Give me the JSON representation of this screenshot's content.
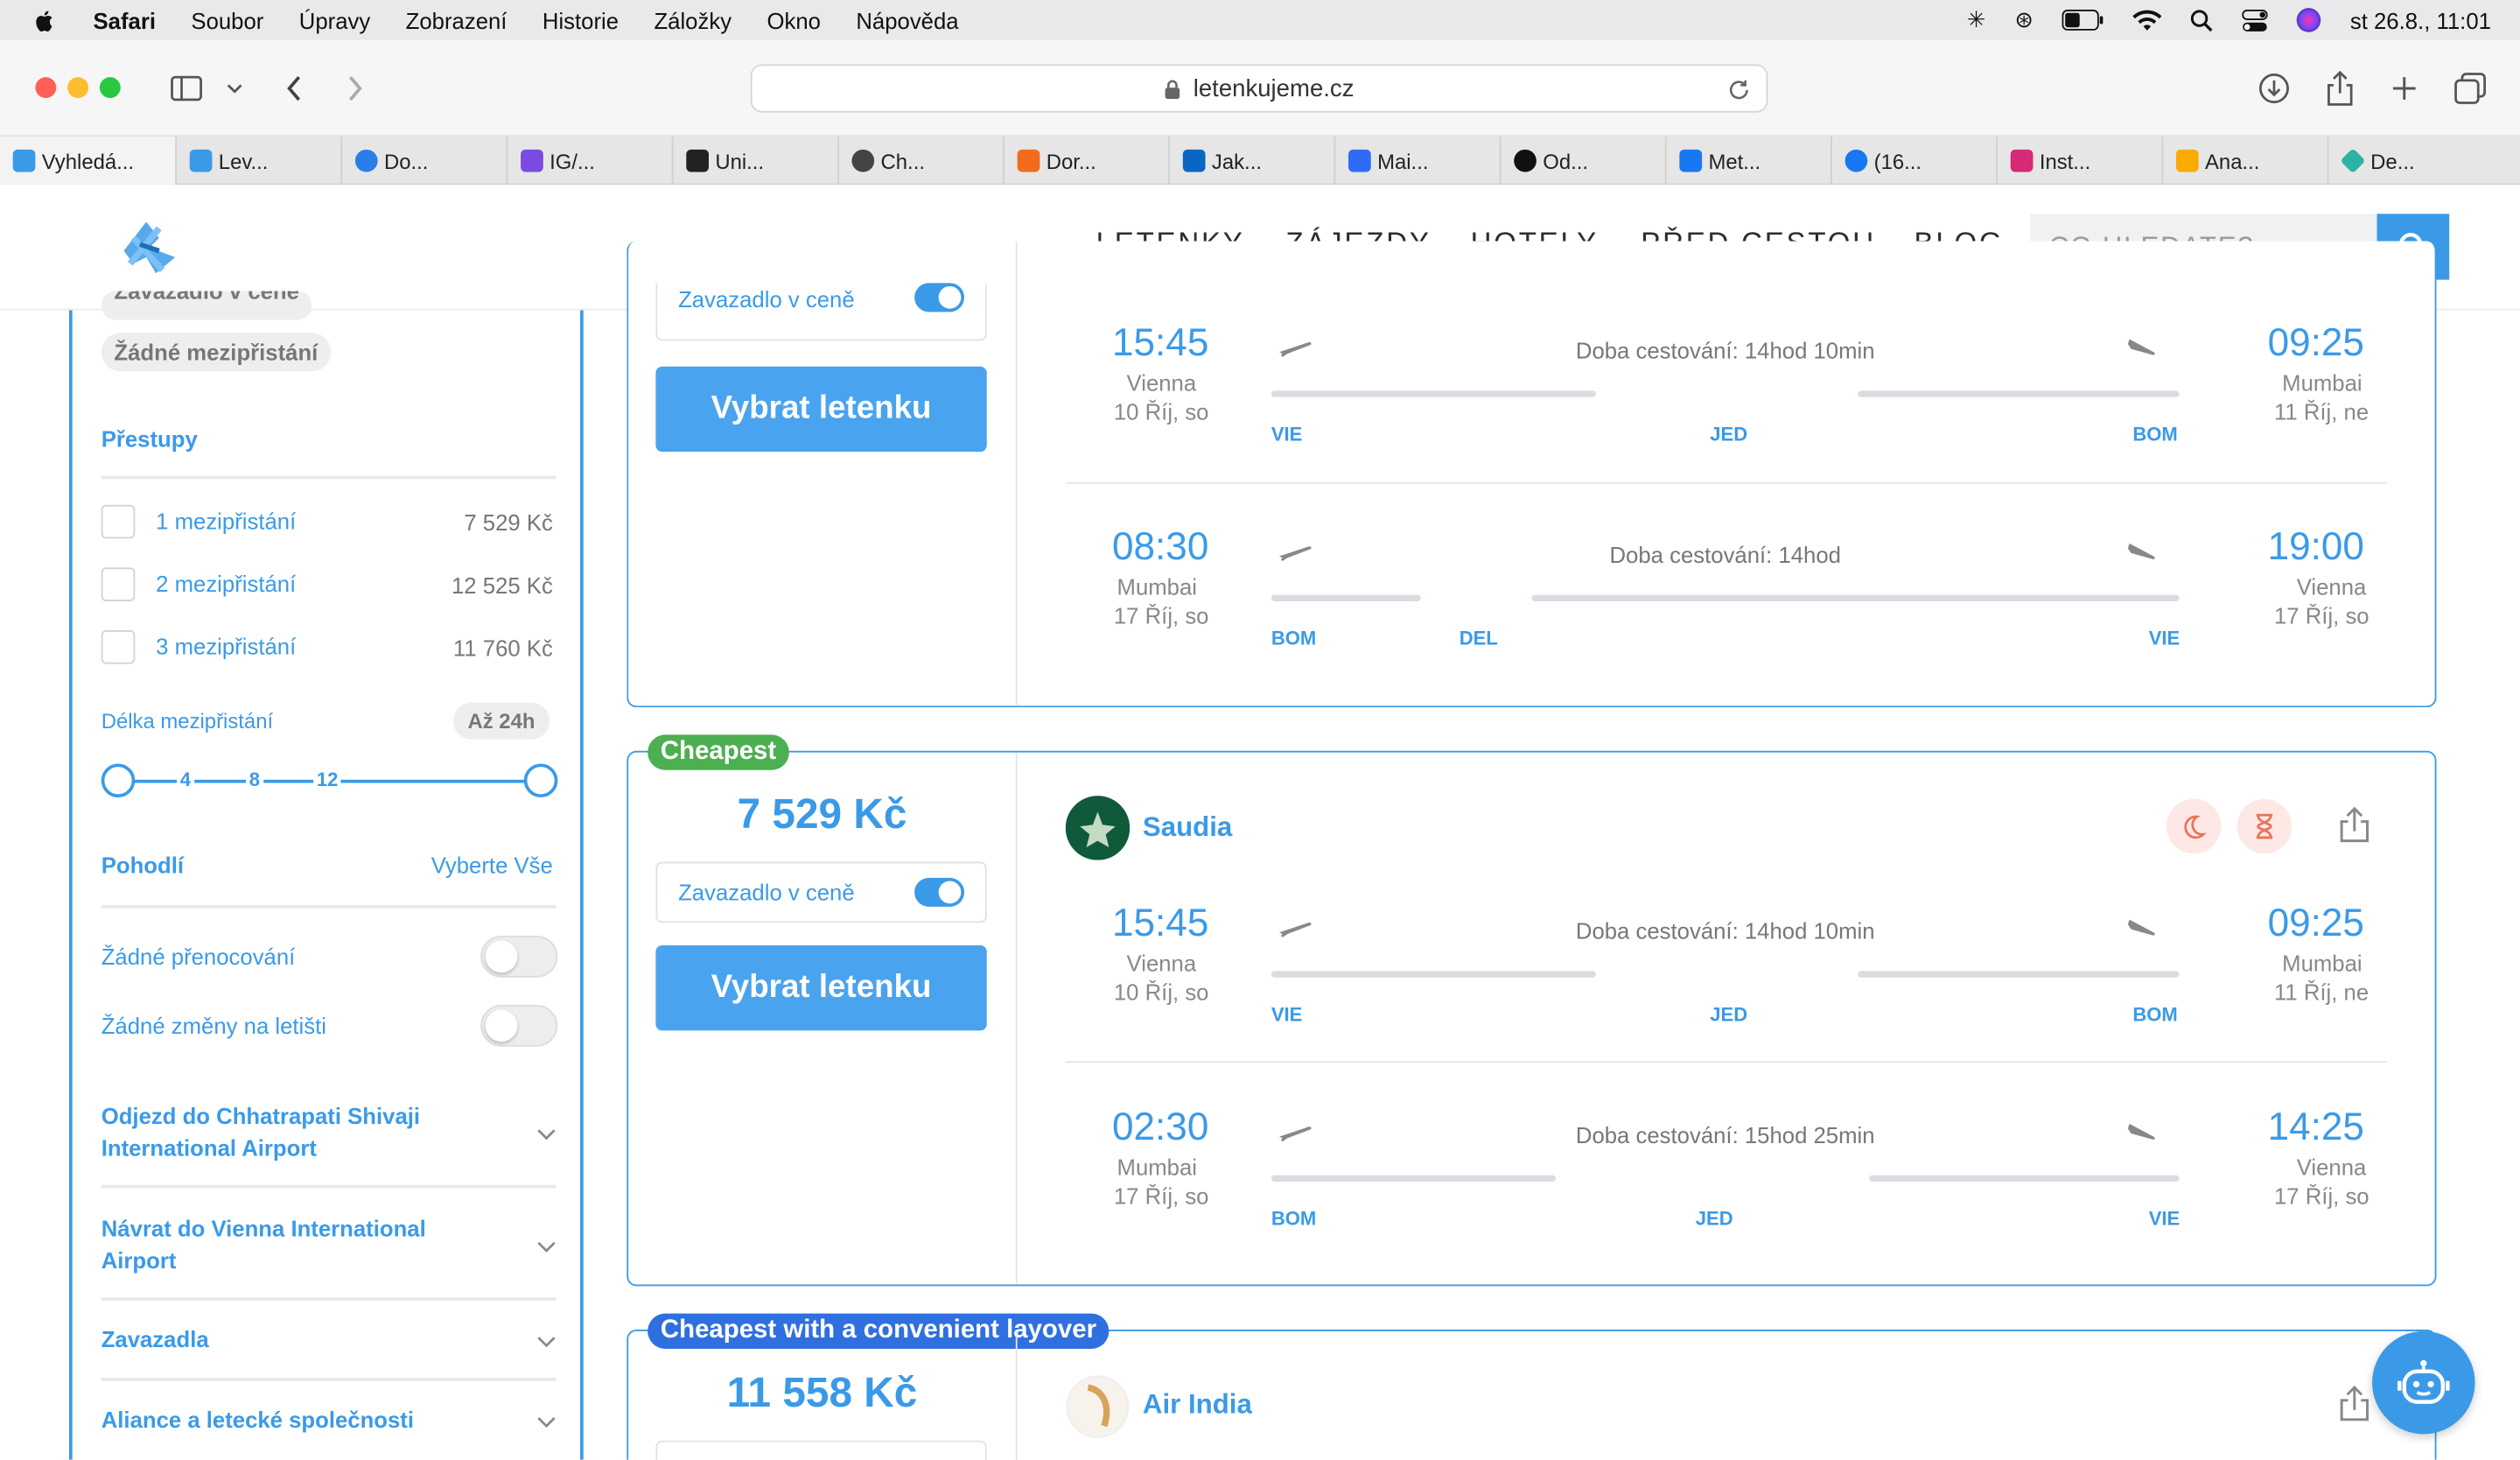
{
  "menubar": {
    "app": "Safari",
    "items": [
      "Soubor",
      "Úpravy",
      "Zobrazení",
      "Historie",
      "Záložky",
      "Okno",
      "Nápověda"
    ],
    "clock": "st 26.8., 11:01"
  },
  "browser": {
    "url": "letenkujeme.cz",
    "tabs": [
      {
        "label": "Vyhledá...",
        "color": "#3a9ae8"
      },
      {
        "label": "Lev...",
        "color": "#3a9ae8"
      },
      {
        "label": "Do...",
        "color": "#2b7de9"
      },
      {
        "label": "IG/...",
        "color": "#7b4ae2"
      },
      {
        "label": "Uni...",
        "color": "#222222"
      },
      {
        "label": "Ch...",
        "color": "#444444"
      },
      {
        "label": "Dor...",
        "color": "#f26b1d"
      },
      {
        "label": "Jak...",
        "color": "#0a66c2"
      },
      {
        "label": "Mai...",
        "color": "#2f6cf6"
      },
      {
        "label": "Od...",
        "color": "#111111"
      },
      {
        "label": "Met...",
        "color": "#1877f2"
      },
      {
        "label": "(16...",
        "color": "#1877f2"
      },
      {
        "label": "Inst...",
        "color": "#d62976"
      },
      {
        "label": "Ana...",
        "color": "#f9ab00"
      },
      {
        "label": "De...",
        "color": "#2bb3a3"
      }
    ]
  },
  "header": {
    "nav": [
      "LETENKY",
      "ZÁJEZDY",
      "HOTELY",
      "PŘED CESTOU",
      "BLOG"
    ],
    "search_placeholder": "CO HLEDATE?"
  },
  "sidebar": {
    "tag_cut": "Zavazadlo v ceně",
    "tag": "Žádné mezipřistání",
    "transfers_title": "Přestupy",
    "transfers": [
      {
        "label": "1 mezipřistání",
        "price": "7 529 Kč"
      },
      {
        "label": "2 mezipřistání",
        "price": "12 525 Kč"
      },
      {
        "label": "3 mezipřistání",
        "price": "11 760 Kč"
      }
    ],
    "layover_title": "Délka mezipřistání",
    "layover_value": "Až 24h",
    "slider_ticks": [
      "4",
      "8",
      "12"
    ],
    "comfort_title": "Pohodlí",
    "select_all": "Vyberte Vše",
    "toggles": [
      "Žádné přenocování",
      "Žádné změny na letišti"
    ],
    "accordions": [
      "Odjezd do Chhatrapati Shivaji International Airport",
      "Návrat do Vienna International Airport",
      "Zavazadla",
      "Aliance a letecké společnosti"
    ]
  },
  "cards": [
    {
      "partial_top": true,
      "baggage_label": "Zavazadlo v ceně",
      "select_label": "Vybrat letenku",
      "segments": [
        {
          "dep_time": "15:45",
          "dep_city": "Vienna",
          "dep_date": "10 Říj, so",
          "duration": "Doba cestování: 14hod 10min",
          "arr_time": "09:25",
          "arr_city": "Mumbai",
          "arr_date": "11 Říj, ne",
          "codes": [
            "VIE",
            "JED",
            "BOM"
          ]
        },
        {
          "dep_time": "08:30",
          "dep_city": "Mumbai",
          "dep_date": "17 Říj, so",
          "duration": "Doba cestování: 14hod",
          "arr_time": "19:00",
          "arr_city": "Vienna",
          "arr_date": "17 Říj, so",
          "codes": [
            "BOM",
            "DEL",
            "VIE"
          ]
        }
      ]
    },
    {
      "ribbon": "Cheapest",
      "price": "7 529 Kč",
      "airline": "Saudia",
      "baggage_label": "Zavazadlo v ceně",
      "select_label": "Vybrat letenku",
      "segments": [
        {
          "dep_time": "15:45",
          "dep_city": "Vienna",
          "dep_date": "10 Říj, so",
          "duration": "Doba cestování: 14hod 10min",
          "arr_time": "09:25",
          "arr_city": "Mumbai",
          "arr_date": "11 Říj, ne",
          "codes": [
            "VIE",
            "JED",
            "BOM"
          ]
        },
        {
          "dep_time": "02:30",
          "dep_city": "Mumbai",
          "dep_date": "17 Říj, so",
          "duration": "Doba cestování: 15hod 25min",
          "arr_time": "14:25",
          "arr_city": "Vienna",
          "arr_date": "17 Říj, so",
          "codes": [
            "BOM",
            "JED",
            "VIE"
          ]
        }
      ]
    },
    {
      "ribbon": "Cheapest with a convenient layover",
      "price": "11 558 Kč",
      "airline": "Air India"
    }
  ],
  "colors": {
    "accent": "#3a9ae8",
    "cheapest": "#4caf50",
    "convenient": "#2f6fe0"
  }
}
